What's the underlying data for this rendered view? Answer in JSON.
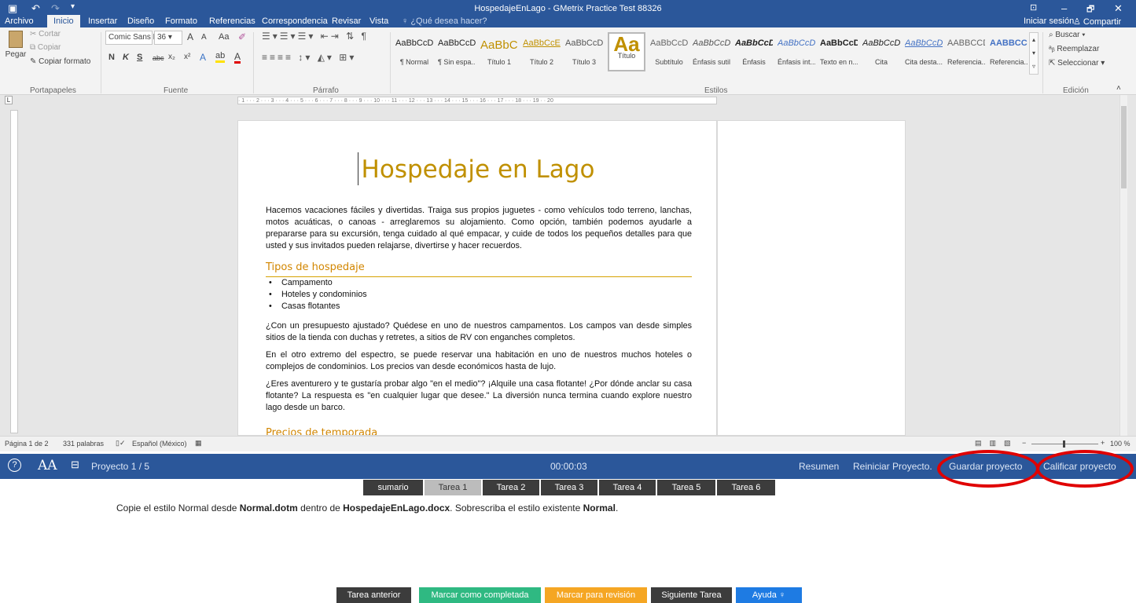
{
  "window": {
    "title": "HospedajeEnLago - GMetrix Practice Test 88326",
    "minimize": "–",
    "restore": "🗗",
    "close": "✕",
    "ribbon_display": "⊡"
  },
  "qat": {
    "save_icon": "save-icon",
    "undo": "↶",
    "redo": "↷"
  },
  "menu": {
    "tabs": [
      "Archivo",
      "Inicio",
      "Insertar",
      "Diseño",
      "Formato",
      "Referencias",
      "Correspondencia",
      "Revisar",
      "Vista"
    ],
    "tell_me": "¿Qué desea hacer?",
    "signin": "Iniciar sesión",
    "share": "Compartir"
  },
  "ribbon": {
    "clipboard": {
      "paste": "Pegar",
      "cut": "Cortar",
      "copy": "Copiar",
      "format_painter": "Copiar formato",
      "group": "Portapapeles"
    },
    "font": {
      "name": "Comic Sans M",
      "size": "36",
      "grow": "A",
      "shrink": "A",
      "case": "Aa",
      "bold": "N",
      "italic": "K",
      "underline": "S",
      "strike": "abc",
      "sub": "x₂",
      "sup": "x²",
      "group": "Fuente"
    },
    "paragraph": {
      "group": "Párrafo"
    },
    "styles": {
      "group": "Estilos",
      "items": [
        {
          "preview": "AaBbCcDc",
          "name": "¶ Normal"
        },
        {
          "preview": "AaBbCcDc",
          "name": "¶ Sin espa..."
        },
        {
          "preview": "AaBbCc",
          "name": "Título 1"
        },
        {
          "preview": "AaBbCcE",
          "name": "Título 2"
        },
        {
          "preview": "AaBbCcD",
          "name": "Título 3"
        },
        {
          "preview": "Aa",
          "name": "Título"
        },
        {
          "preview": "AaBbCcD",
          "name": "Subtítulo"
        },
        {
          "preview": "AaBbCcDc",
          "name": "Énfasis sutil"
        },
        {
          "preview": "AaBbCcDc",
          "name": "Énfasis"
        },
        {
          "preview": "AaBbCcDc",
          "name": "Énfasis int..."
        },
        {
          "preview": "AaBbCcDc",
          "name": "Texto en n..."
        },
        {
          "preview": "AaBbCcDc",
          "name": "Cita"
        },
        {
          "preview": "AaBbCcDc",
          "name": "Cita desta..."
        },
        {
          "preview": "AABBCCDE",
          "name": "Referencia..."
        },
        {
          "preview": "AABBCCDE",
          "name": "Referencia..."
        }
      ]
    },
    "editing": {
      "find": "Buscar",
      "replace": "Reemplazar",
      "select": "Seleccionar",
      "group": "Edición"
    }
  },
  "document": {
    "title": "Hospedaje en Lago",
    "intro": "Hacemos vacaciones fáciles y divertidas. Traiga sus propios juguetes - como vehículos todo terreno, lanchas, motos acuáticas, o canoas - arreglaremos su alojamiento. Como opción, también podemos ayudarle a prepararse para su excursión, tenga cuidado al qué empacar, y cuide de todos los pequeños detalles para que usted y sus invitados pueden relajarse, divertirse y hacer recuerdos.",
    "heading1": "Tipos de hospedaje",
    "bullets": [
      "Campamento",
      "Hoteles y condominios",
      "Casas flotantes"
    ],
    "p2": "¿Con un presupuesto ajustado? Quédese en uno de nuestros campamentos. Los campos van desde simples sitios de la tienda con duchas y retretes, a sitios de RV con enganches completos.",
    "p3": "En el otro extremo del espectro, se puede reservar una habitación en uno de nuestros muchos hoteles o complejos de condominios. Los precios van desde económicos hasta de lujo.",
    "p4": "¿Eres aventurero y te gustaría probar algo \"en el medio\"? ¡Alquile una casa flotante! ¿Por dónde anclar su casa flotante? La respuesta es \"en cualquier lugar que desee.\" La diversión nunca termina cuando explore nuestro lago desde un barco.",
    "heading2": "Precios de temporada"
  },
  "status": {
    "page": "Página 1 de 2",
    "words": "331 palabras",
    "language": "Español (México)",
    "zoom": "100 %"
  },
  "gmetrix": {
    "help": "?",
    "font_size": "AA",
    "project": "Proyecto 1 / 5",
    "timer": "00:00:03",
    "summary": "Resumen",
    "restart": "Reiniciar Proyecto.",
    "save": "Guardar proyecto",
    "grade": "Calificar proyecto",
    "tabs": [
      "sumario",
      "Tarea 1",
      "Tarea 2",
      "Tarea 3",
      "Tarea 4",
      "Tarea 5",
      "Tarea 6"
    ],
    "task_parts": [
      "Copie el estilo Normal desde ",
      "Normal.dotm",
      " dentro de ",
      "HospedajeEnLago.docx",
      ". Sobrescriba el estilo existente ",
      "Normal",
      "."
    ],
    "buttons": {
      "prev": "Tarea anterior",
      "complete": "Marcar como completada",
      "review": "Marcar para revisión",
      "next": "Siguiente Tarea",
      "help": "Ayuda"
    }
  },
  "colors": {
    "word_blue": "#2b579a",
    "heading_gold": "#c09000",
    "annotation_red": "#e00000",
    "complete_green": "#2fb982",
    "review_orange": "#f5a623",
    "help_blue": "#1e7be3"
  }
}
